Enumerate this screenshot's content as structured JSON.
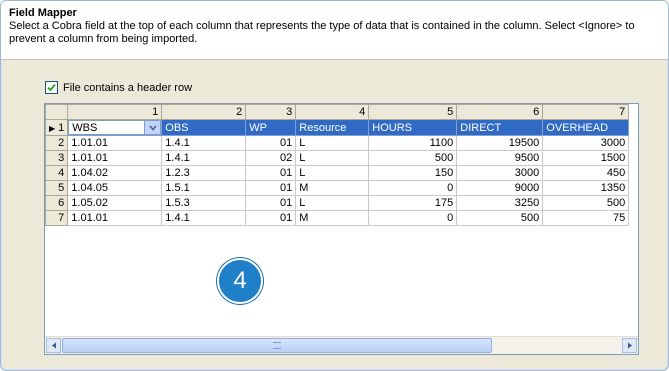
{
  "dialog": {
    "title": "Field Mapper",
    "description": "Select a Cobra field at the top of each column that represents the type of data that is contained in the column. Select <Ignore> to prevent a column from being imported."
  },
  "header_row_checkbox": {
    "label": "File contains a header row",
    "checked": true
  },
  "grid": {
    "column_numbers": [
      "1",
      "2",
      "3",
      "4",
      "5",
      "6",
      "7"
    ],
    "mapping_row": {
      "row_number": "1",
      "fields": [
        "WBS",
        "OBS",
        "WP",
        "Resource",
        "HOURS",
        "DIRECT",
        "OVERHEAD"
      ]
    },
    "rows": [
      {
        "n": "2",
        "cells": [
          "1.01.01",
          "1.4.1",
          "01",
          "L",
          "1100",
          "19500",
          "3000"
        ]
      },
      {
        "n": "3",
        "cells": [
          "1.01.01",
          "1.4.1",
          "02",
          "L",
          "500",
          "9500",
          "1500"
        ]
      },
      {
        "n": "4",
        "cells": [
          "1.04.02",
          "1.2.3",
          "01",
          "L",
          "150",
          "3000",
          "450"
        ]
      },
      {
        "n": "5",
        "cells": [
          "1.04.05",
          "1.5.1",
          "01",
          "M",
          "0",
          "9000",
          "1350"
        ]
      },
      {
        "n": "6",
        "cells": [
          "1.05.02",
          "1.5.3",
          "01",
          "L",
          "175",
          "3250",
          "500"
        ]
      },
      {
        "n": "7",
        "cells": [
          "1.01.01",
          "1.4.1",
          "01",
          "M",
          "0",
          "500",
          "75"
        ]
      }
    ]
  },
  "callout": {
    "number": "4"
  },
  "colors": {
    "selection": "#316ac5",
    "callout": "#1f7fc8",
    "background": "#ece9d8"
  }
}
